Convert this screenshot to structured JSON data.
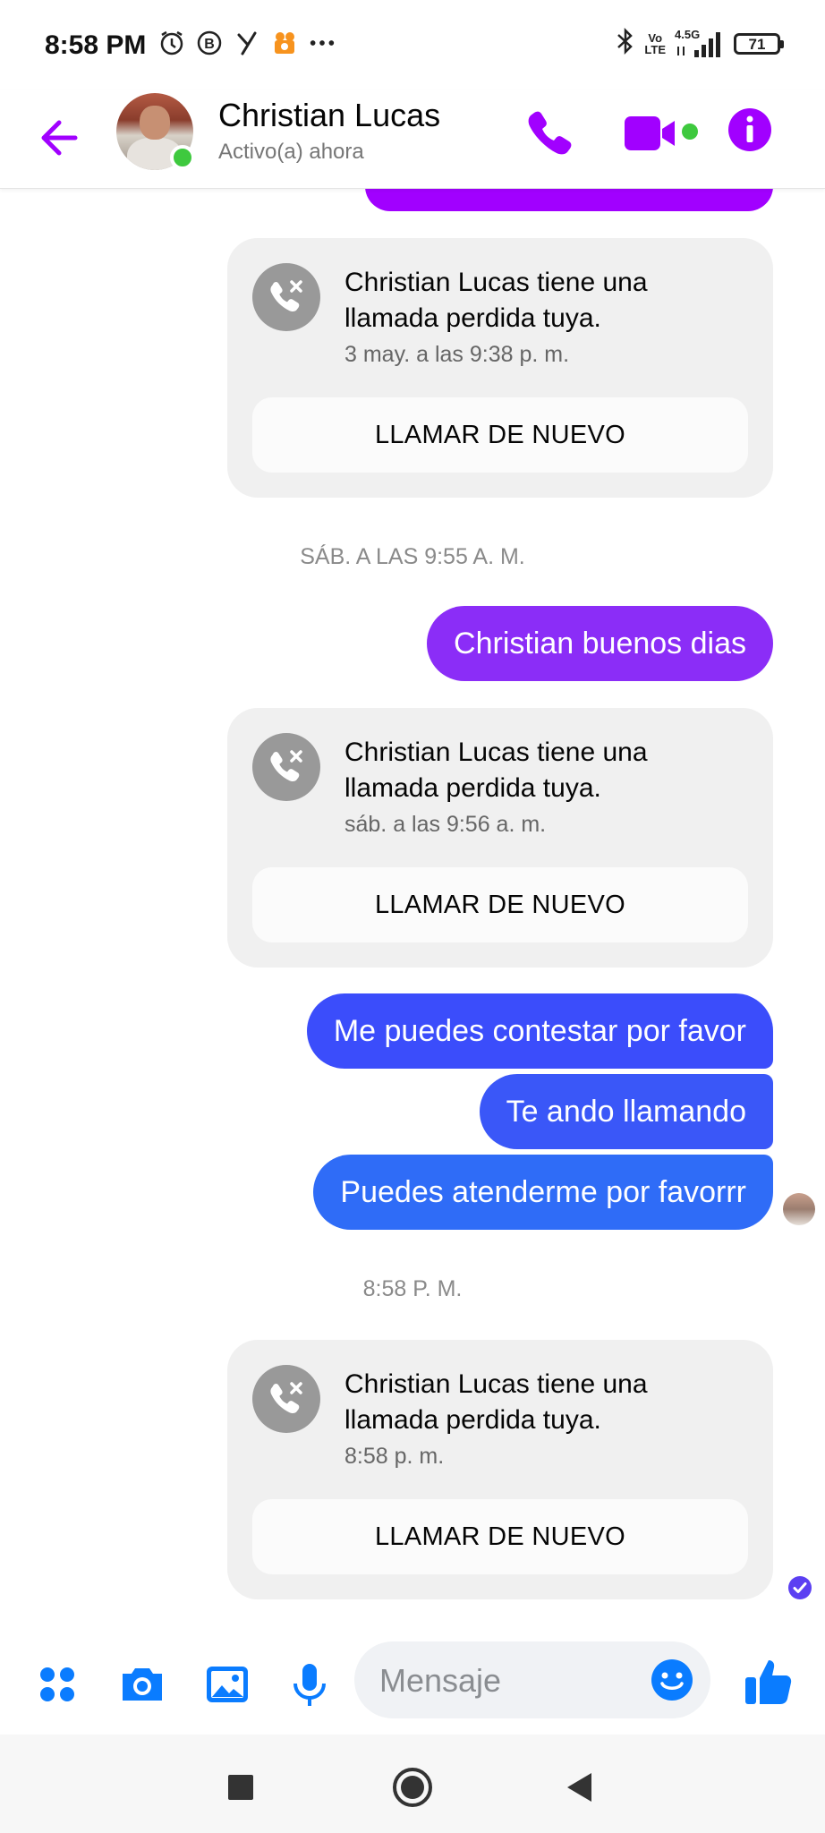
{
  "status_bar": {
    "time": "8:58 PM",
    "volte_top": "Vo",
    "volte_bottom": "LTE",
    "network": "4.5G",
    "battery": "71",
    "icons": [
      "alarm-icon",
      "b-badge-icon",
      "y-app-icon",
      "media-app-icon",
      "more-dots-icon",
      "bluetooth-icon",
      "signal-icon"
    ]
  },
  "header": {
    "contact_name": "Christian Lucas",
    "presence": "Activo(a) ahora",
    "accent_color": "#a100ff",
    "online_color": "#3ec93e"
  },
  "conversation": {
    "missed_calls": [
      {
        "text": "Christian Lucas tiene una llamada perdida tuya.",
        "time": "3 may. a las 9:38 p. m.",
        "action": "LLAMAR DE NUEVO"
      },
      {
        "text": "Christian Lucas tiene una llamada perdida tuya.",
        "time": "sáb. a las 9:56 a. m.",
        "action": "LLAMAR DE NUEVO"
      },
      {
        "text": "Christian Lucas tiene una llamada perdida tuya.",
        "time": "8:58 p. m.",
        "action": "LLAMAR DE NUEVO"
      }
    ],
    "day_separators": [
      "SÁB. A LAS 9:55 A. M.",
      "8:58 P. M."
    ],
    "outgoing": [
      "Christian buenos dias",
      "Me puedes contestar por favor",
      "Te ando llamando",
      "Puedes atenderme por favorrr"
    ]
  },
  "composer": {
    "placeholder": "Mensaje",
    "icon_color": "#0a7cff"
  }
}
